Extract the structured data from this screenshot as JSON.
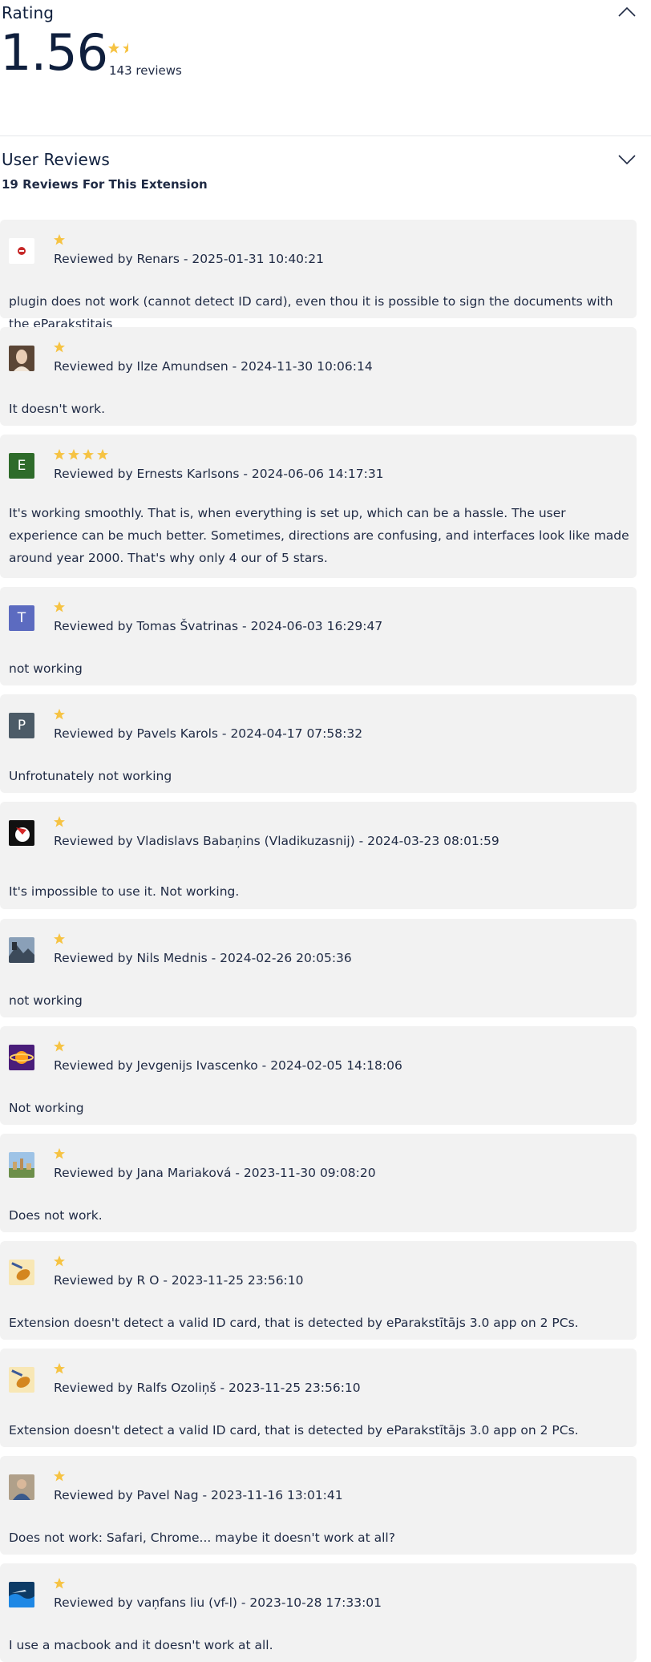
{
  "rating": {
    "title": "Rating",
    "score": "1.56",
    "review_count": "143 reviews",
    "score_stars": 1.5
  },
  "user_reviews": {
    "title": "User Reviews",
    "subtitle": "19 Reviews For This Extension"
  },
  "colors": {
    "star": "#f6c343",
    "card_bg": "#f2f2f2",
    "text_dark": "#0f1f3d"
  },
  "reviews": [
    {
      "stars": 1,
      "byline": "Reviewed by Renars - 2025-01-31 10:40:21",
      "text": "plugin does not work (cannot detect ID card), even thou it is possible to sign the documents with the eParakstitajs",
      "avatar": {
        "kind": "image",
        "icon": "red-emblem-avatar"
      }
    },
    {
      "stars": 1,
      "byline": "Reviewed by Ilze Amundsen - 2024-11-30 10:06:14",
      "text": "It doesn't work.",
      "avatar": {
        "kind": "image",
        "icon": "portrait-photo-avatar"
      }
    },
    {
      "stars": 4,
      "byline": "Reviewed by Ernests Karlsons - 2024-06-06 14:17:31",
      "text": "It's working smoothly. That is, when everything is set up, which can be a hassle. The user experience can be much better. Sometimes, directions are confusing, and interfaces look like made around year 2000. That's why only 4 our of 5 stars.",
      "avatar": {
        "kind": "letter",
        "letter": "E",
        "color": "#2e6b2a"
      }
    },
    {
      "stars": 1,
      "byline": "Reviewed by Tomas Švatrinas - 2024-06-03 16:29:47",
      "text": "not working",
      "avatar": {
        "kind": "letter",
        "letter": "T",
        "color": "#5c6bc0"
      }
    },
    {
      "stars": 1,
      "byline": "Reviewed by Pavels Karols - 2024-04-17 07:58:32",
      "text": "Unfrotunately not working",
      "avatar": {
        "kind": "letter",
        "letter": "P",
        "color": "#4c5b67"
      }
    },
    {
      "stars": 1,
      "byline": "Reviewed by Vladislavs Babaņins (Vladikuzasnij) - 2024-03-23 08:01:59",
      "text": "It's impossible to use it. Not working.",
      "avatar": {
        "kind": "image",
        "icon": "clock-logo-avatar"
      }
    },
    {
      "stars": 1,
      "byline": "Reviewed by Nils Mednis - 2024-02-26 20:05:36",
      "text": "not working",
      "avatar": {
        "kind": "image",
        "icon": "landscape-photo-avatar"
      }
    },
    {
      "stars": 1,
      "byline": "Reviewed by Jevgenijs Ivascenko - 2024-02-05 14:18:06",
      "text": "Not working",
      "avatar": {
        "kind": "image",
        "icon": "planet-avatar"
      }
    },
    {
      "stars": 1,
      "byline": "Reviewed by Jana Mariaková - 2023-11-30 09:08:20",
      "text": "Does not work.",
      "avatar": {
        "kind": "image",
        "icon": "city-photo-avatar"
      }
    },
    {
      "stars": 1,
      "byline": "Reviewed by R O - 2023-11-25 23:56:10",
      "text": "Extension doesn't detect a valid ID card, that is detected by eParakstītājs 3.0 app on 2 PCs.",
      "avatar": {
        "kind": "image",
        "icon": "violin-avatar"
      }
    },
    {
      "stars": 1,
      "byline": "Reviewed by Ralfs Ozoliņš - 2023-11-25 23:56:10",
      "text": "Extension doesn't detect a valid ID card, that is detected by eParakstītājs 3.0 app on 2 PCs.",
      "avatar": {
        "kind": "image",
        "icon": "violin-avatar"
      }
    },
    {
      "stars": 1,
      "byline": "Reviewed by Pavel Nag - 2023-11-16 13:01:41",
      "text": "Does not work: Safari, Chrome... maybe it doesn't work at all?",
      "avatar": {
        "kind": "image",
        "icon": "person-photo-avatar"
      }
    },
    {
      "stars": 1,
      "byline": "Reviewed by vaņfans liu (vf-l) - 2023-10-28 17:33:01",
      "text": "I use a macbook and it doesn't work at all.",
      "avatar": {
        "kind": "image",
        "icon": "ocean-photo-avatar"
      }
    }
  ]
}
